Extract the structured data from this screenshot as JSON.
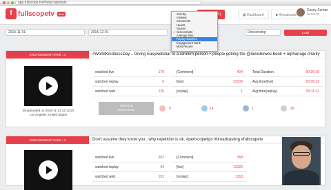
{
  "browser": {
    "url": "app.fullscope.tv/#/fullscopestats"
  },
  "brand": {
    "logo_letter": "f",
    "name": "fullscopetv",
    "badge": "Beta",
    "accent": "#e5404b"
  },
  "nav": {
    "stats": "Periscope(4)",
    "dashboard": "Dashboard",
    "broadcasts": "Broadcasts"
  },
  "user": {
    "name": "Casey Zeman",
    "sub": "Account"
  },
  "filters": {
    "from": "2015-11-01",
    "to": "2015-12-01",
    "order": "Descending",
    "load": "Load"
  },
  "sort_menu": {
    "items": [
      "Sort By",
      "Viewers",
      "Comments",
      "Hearts",
      "Shares",
      "Screenshots",
      "Average time",
      "Replay watched",
      "Engagement Rank",
      "Most Recent"
    ],
    "checked": "Screenshots",
    "highlighted": "Replay watched"
  },
  "cards": [
    {
      "rank": "ENGAGEMENT RANK : 3",
      "caption": "#WorldKindnessDay... Giving Easywebinar to a random person + people getting the @lewishowes book + orphanage charity",
      "broadcast": "Broadcasted on 2015-11-13 13:13:20",
      "location": "Los Angeles, United States",
      "stats": {
        "live_label": "watched live",
        "live": "170",
        "replay_label": "watched replay",
        "replay": "6",
        "web_label": "watched web",
        "web": "135",
        "comment_label": "[Comment]",
        "comment": "404",
        "hearts_label": "[live]",
        "hearts": "22109",
        "hreplay_label": "[replay]",
        "hreplay": "1",
        "total_label": "Total Duration",
        "total": "00:26:10",
        "avglive_label": "Avg time(live)",
        "avglive": "00:06:12",
        "avgrep_label": "Avg time(replay)",
        "avgrep": "00:11:12"
      },
      "share": {
        "label": "Shares &",
        "label2": "Screenshots",
        "s1": "9",
        "s2": "14",
        "s3": "1",
        "s4": "28"
      }
    },
    {
      "rank": "ENGAGEMENT RANK : 3",
      "caption": "Don't assume they know you...why repetition is ok. #periscopetips #broadcasting #fullscopetv",
      "stats": {
        "live_label": "watched live",
        "live": "302",
        "replay_label": "watched replay",
        "replay": "54",
        "web_label": "watched web",
        "web": "152",
        "comment_label": "[Comment]",
        "comment": "358",
        "hearts_label": "[live]",
        "hearts": "13126",
        "hreplay_label": "[replay]",
        "hreplay": "1163"
      }
    }
  ]
}
